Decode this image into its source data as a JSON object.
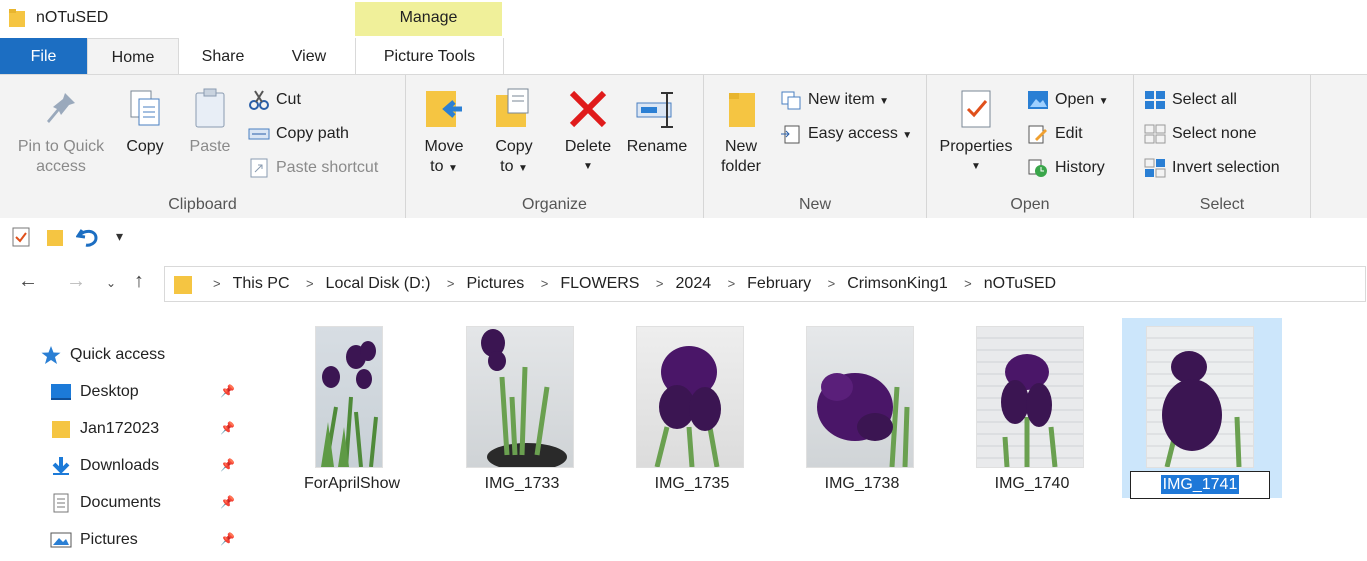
{
  "window": {
    "title": "nOTuSED",
    "context_tab": "Manage"
  },
  "tabs": [
    "File",
    "Home",
    "Share",
    "View",
    "Picture Tools"
  ],
  "ribbon": {
    "clipboard": {
      "label": "Clipboard",
      "pin_line1": "Pin to Quick",
      "pin_line2": "access",
      "copy": "Copy",
      "paste": "Paste",
      "cut": "Cut",
      "copy_path": "Copy path",
      "paste_shortcut": "Paste shortcut"
    },
    "organize": {
      "label": "Organize",
      "move_line1": "Move",
      "move_line2": "to",
      "copy_line1": "Copy",
      "copy_line2": "to",
      "delete": "Delete",
      "rename": "Rename"
    },
    "new": {
      "label": "New",
      "folder_line1": "New",
      "folder_line2": "folder",
      "new_item": "New item",
      "easy_access": "Easy access"
    },
    "open": {
      "label": "Open",
      "properties": "Properties",
      "open": "Open",
      "edit": "Edit",
      "history": "History"
    },
    "select": {
      "label": "Select",
      "select_all": "Select all",
      "select_none": "Select none",
      "invert": "Invert selection"
    }
  },
  "breadcrumb": [
    "This PC",
    "Local Disk (D:)",
    "Pictures",
    "FLOWERS",
    "2024",
    "February",
    "CrimsonKing1",
    "nOTuSED"
  ],
  "nav": {
    "quick_access": "Quick access",
    "items": [
      "Desktop",
      "Jan172023",
      "Downloads",
      "Documents",
      "Pictures"
    ]
  },
  "files": [
    {
      "name": "ForAprilShow"
    },
    {
      "name": "IMG_1733"
    },
    {
      "name": "IMG_1735"
    },
    {
      "name": "IMG_1738"
    },
    {
      "name": "IMG_1740"
    },
    {
      "name": "IMG_1741"
    }
  ],
  "colors": {
    "file_tab": "#1c6ec2",
    "manage_tab": "#f0f09a",
    "selection": "#cce6fb",
    "rename_highlight": "#1e78d8"
  }
}
